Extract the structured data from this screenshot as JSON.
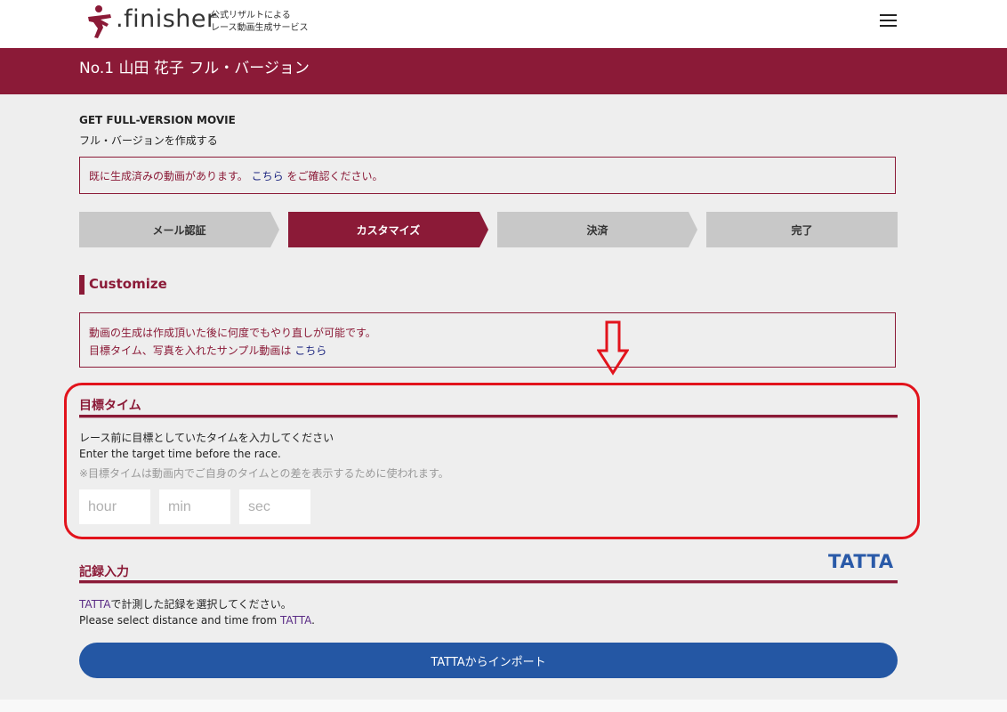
{
  "header": {
    "logo_text": ".finisher",
    "tagline_line1": "公式リザルトによる",
    "tagline_line2": "レース動画生成サービス"
  },
  "title_band": {
    "title": "No.1 山田 花子 フル・バージョン"
  },
  "intro": {
    "heading_en": "GET FULL-VERSION MOVIE",
    "heading_ja": "フル・バージョンを作成する"
  },
  "notice_existing": {
    "before": "既に生成済みの動画があります。 ",
    "link": "こちら",
    "after": " をご確認ください。"
  },
  "steps": [
    {
      "label": "メール認証",
      "active": false
    },
    {
      "label": "カスタマイズ",
      "active": true
    },
    {
      "label": "決済",
      "active": false
    },
    {
      "label": "完了",
      "active": false
    }
  ],
  "customize": {
    "label": "Customize",
    "notice_line1": "動画の生成は作成頂いた後に何度でもやり直しが可能です。",
    "notice_line2_before": "目標タイム、写真を入れたサンプル動画は ",
    "notice_line2_link": "こちら"
  },
  "target_time": {
    "title": "目標タイム",
    "desc_ja": "レース前に目標としていたタイムを入力してください",
    "desc_en": "Enter the target time before the race.",
    "note": "※目標タイムは動画内でご自身のタイムとの差を表示するために使われます。",
    "hour_placeholder": "hour",
    "min_placeholder": "min",
    "sec_placeholder": "sec"
  },
  "record": {
    "title": "記録入力",
    "logo": "TATTA",
    "desc_ja_brand": "TATTA",
    "desc_ja_rest": "で計測した記録を選択してください。",
    "desc_en_before": "Please select distance and time from ",
    "desc_en_brand": "TATTA",
    "desc_en_after": ".",
    "import_button": "TATTAからインポート"
  },
  "colors": {
    "brand": "#8b1a37",
    "highlight": "#e2131c",
    "button": "#2457a4",
    "link": "#1a237e"
  }
}
